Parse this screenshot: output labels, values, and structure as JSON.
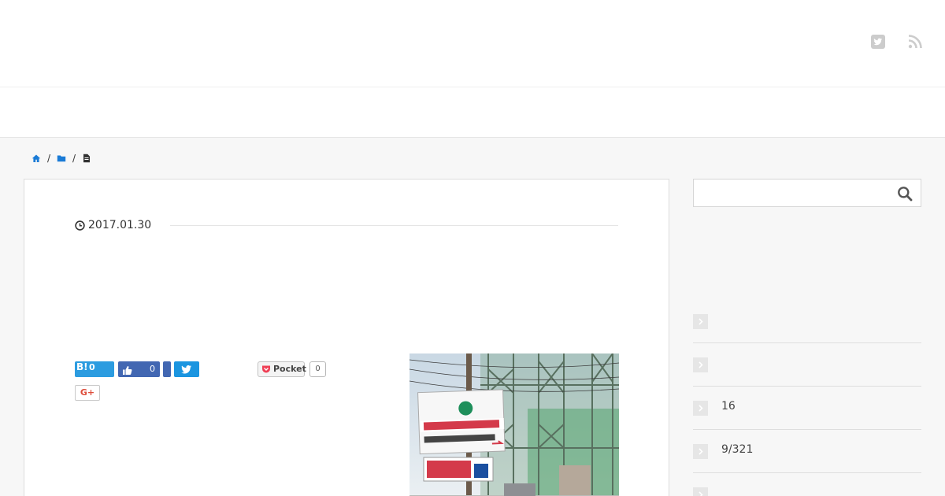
{
  "header": {
    "social_icons": [
      "twitter-icon",
      "rss-icon"
    ],
    "icon_color": "#cccccc"
  },
  "breadcrumb": {
    "items": [
      "home-icon",
      "folder-icon",
      "document-icon"
    ],
    "separator": "/",
    "link_color": "#1a7bd6"
  },
  "article": {
    "date": "2017.01.30",
    "share": {
      "hatena_label": "B!",
      "hatena_count": "0",
      "facebook_like_count": "0",
      "pocket_label": "Pocket",
      "pocket_count": "0",
      "gplus_label": "G+"
    }
  },
  "sidebar": {
    "search_placeholder": "",
    "list_items": [
      {
        "label": ""
      },
      {
        "label": ""
      },
      {
        "label": "16"
      },
      {
        "label": "9/321"
      },
      {
        "label": ""
      }
    ]
  },
  "colors": {
    "hatena": "#2c9ce0",
    "facebook": "#4267b2",
    "twitter": "#1b95e0",
    "pocket_red": "#ef4056",
    "gplus": "#dd4b39"
  }
}
